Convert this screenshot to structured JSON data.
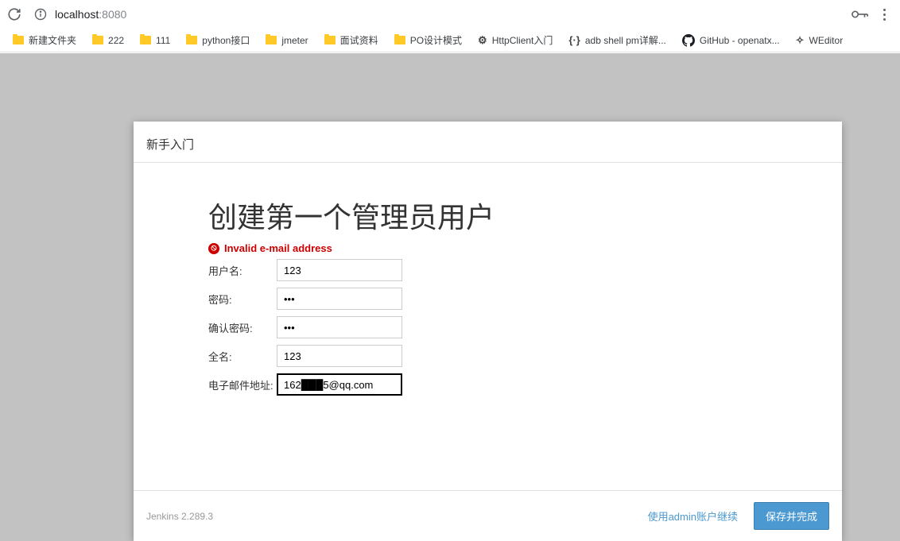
{
  "browser": {
    "url_host": "localhost",
    "url_port": ":8080"
  },
  "bookmarks": [
    {
      "label": "新建文件夹",
      "icon": "folder"
    },
    {
      "label": "222",
      "icon": "folder"
    },
    {
      "label": "111",
      "icon": "folder"
    },
    {
      "label": "python接口",
      "icon": "folder"
    },
    {
      "label": "jmeter",
      "icon": "folder"
    },
    {
      "label": "面试资料",
      "icon": "folder"
    },
    {
      "label": "PO设计模式",
      "icon": "folder"
    },
    {
      "label": "HttpClient入门",
      "icon": "custom-http"
    },
    {
      "label": "adb shell pm详解...",
      "icon": "custom-adb"
    },
    {
      "label": "GitHub - openatx...",
      "icon": "github"
    },
    {
      "label": "WEditor",
      "icon": "custom-w"
    }
  ],
  "modal": {
    "header": "新手入门",
    "title": "创建第一个管理员用户",
    "error": "Invalid e-mail address",
    "fields": {
      "username": {
        "label": "用户名:",
        "value": "123"
      },
      "password": {
        "label": "密码:",
        "value": "•••"
      },
      "confirm": {
        "label": "确认密码:",
        "value": "•••"
      },
      "fullname": {
        "label": "全名:",
        "value": "123"
      },
      "email": {
        "label": "电子邮件地址:",
        "value": "162███5@qq.com"
      }
    },
    "footer": {
      "version": "Jenkins 2.289.3",
      "skip_label": "使用admin账户继续",
      "save_label": "保存并完成"
    }
  }
}
